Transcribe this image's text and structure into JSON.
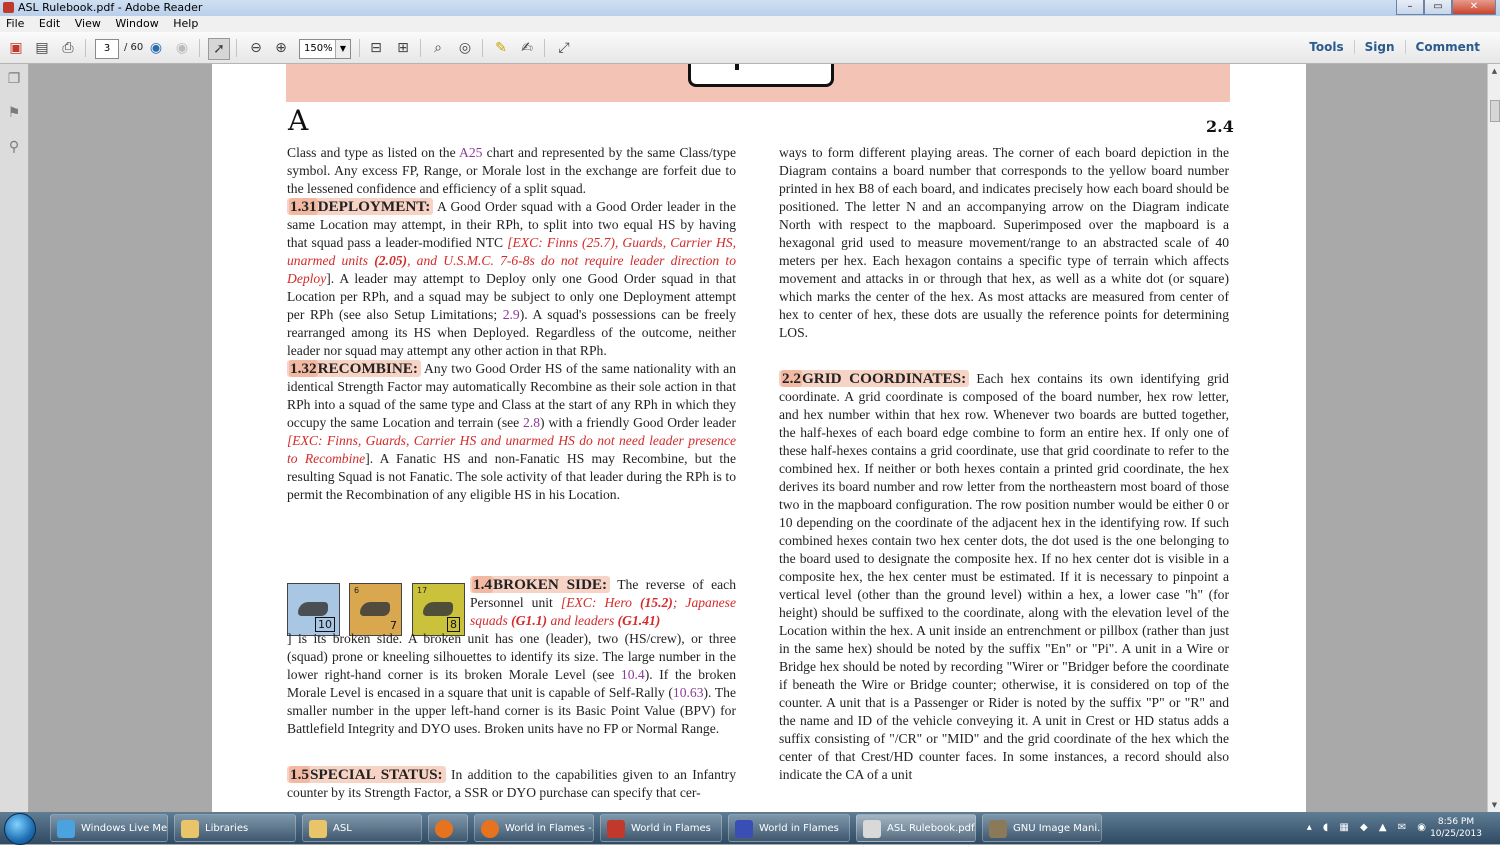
{
  "window": {
    "title": "ASL Rulebook.pdf - Adobe Reader",
    "min": "–",
    "max": "▭",
    "close": "✕"
  },
  "menu": [
    "File",
    "Edit",
    "View",
    "Window",
    "Help"
  ],
  "toolbar": {
    "page_current": "3",
    "page_total": "/ 60",
    "zoom": "150%",
    "links": {
      "tools": "Tools",
      "sign": "Sign",
      "comment": "Comment"
    }
  },
  "icons": {
    "create": "create-pdf-icon",
    "save": "save-icon",
    "print": "print-icon",
    "prev": "previous-page-icon",
    "next": "next-page-icon",
    "select": "select-tool-icon",
    "zoom_out": "zoom-out-icon",
    "zoom_in": "zoom-in-icon",
    "fit_page": "fit-page-icon",
    "fit_width": "fit-width-icon",
    "find": "find-icon",
    "binoculars": "binoculars-icon",
    "comment": "comment-icon",
    "sign": "sign-icon",
    "fullscreen": "fullscreen-icon"
  },
  "document": {
    "section_letter": "A",
    "section_number": "2.4",
    "left": {
      "p0": "Class and type as listed on the ",
      "p0_ref": "A25",
      "p0_b": " chart and represented by the same Class/type symbol. Any excess FP, Range, or Morale lost in the exchange are forfeit due to the lessened confidence and efficiency of a split squad.",
      "r131_num": "1.31",
      "r131_title": "DEPLOYMENT:",
      "r131_a": " A Good Order squad with a Good Order leader in the same Location may attempt, in their RPh, to split into two equal HS by having that squad pass a leader-modified NTC ",
      "r131_exc1": "[EXC: Finns (25.7), Guards, Carrier HS, unarmed units ",
      "r131_excb": "(2.05)",
      "r131_exc2": ", and U.S.M.C. 7-6-8s do not require leader direction to Deploy",
      "r131_b": "]. A leader may attempt to Deploy only one Good Order squad in that Location per RPh, and a squad may be subject to only one Deployment attempt per RPh (see also Setup Limitations; ",
      "r131_ref": "2.9",
      "r131_c": "). A squad's possessions can be freely rearranged among its HS when Deployed. Regardless of the outcome, neither leader nor squad may attempt any other action in that RPh.",
      "r132_num": "1.32",
      "r132_title": "RECOMBINE:",
      "r132_a": " Any two Good Order HS of the same nationality with an identical Strength Factor may automatically Recombine as their sole action in that RPh into a squad of the same type and Class at the start of any RPh in which they occupy the same Location and terrain (see ",
      "r132_ref": "2.8",
      "r132_b": ") with a friendly Good Order leader ",
      "r132_exc": "[EXC: Finns, Guards, Carrier HS and unarmed HS do not need leader presence to Recombine",
      "r132_c": "]. A Fanatic HS and non-Fanatic HS may Recombine, but the resulting Squad is not Fanatic. The sole activity of that leader during the RPh is to permit the Recombination of any eligible HS in his Location.",
      "r14_num": "1.4",
      "r14_title": "BROKEN SIDE:",
      "r14_a": " The reverse of each Personnel unit ",
      "r14_exc1": "[EXC: Hero ",
      "r14_excb1": "(15.2)",
      "r14_exc2": "; Japanese squads ",
      "r14_excb2": "(G1.1)",
      "r14_exc3": " and leaders ",
      "r14_excb3": "(G1.41)",
      "r14_b": "] is its broken side. A broken unit has one (leader), two (HS/crew), or three (squad) prone or kneeling silhouettes to identify its size. The large number in the lower right-hand corner is its broken Morale Level (see ",
      "r14_ref1": "10.4",
      "r14_c": "). If the broken Morale Level is encased in a square that unit is capable of Self-Rally (",
      "r14_ref2": "10.63",
      "r14_d": "). The smaller number in the upper left-hand corner is its Basic Point Value (BPV) for Battlefield Integrity and DYO uses. Broken units have no FP or Normal Range.",
      "r15_num": "1.5",
      "r15_title": "SPECIAL STATUS:",
      "r15_a": " In addition to the capabilities given to an Infantry counter by its Strength Factor, a SSR or DYO purchase can specify that cer-"
    },
    "counters": [
      {
        "bpv": "",
        "morale": "10",
        "boxed": true,
        "color": "#a9c7e3"
      },
      {
        "bpv": "6",
        "morale": "7",
        "boxed": false,
        "color": "#d9a84e"
      },
      {
        "bpv": "17",
        "morale": "8",
        "boxed": true,
        "color": "#c9c23a"
      }
    ],
    "right": {
      "p0": "ways to form different playing areas. The corner of each board depiction in the Diagram contains a board number that corresponds to the yellow board number printed in hex B8 of each board, and indicates precisely how each board should be positioned. The letter N and an accompanying arrow on the Diagram indicate North with respect to the mapboard. Superimposed over the mapboard is a hexagonal grid used to measure movement/range to an abstracted scale of 40 meters per hex. Each hexagon contains a specific type of terrain which affects movement and attacks in or through that hex, as well as a white dot (or square) which marks the center of the hex. As most attacks are measured from center of hex to center of hex, these dots are usually the reference points for determining LOS.",
      "r22_num": "2.2",
      "r22_title": "GRID COORDINATES:",
      "r22_text": " Each hex contains its own identifying grid coordinate. A grid coordinate is composed of the board number, hex row letter, and hex number within that hex row. Whenever two boards are butted together, the half-hexes of each board edge combine to form an entire hex. If only one of these half-hexes contains a grid coordinate, use that grid coordinate to refer to the combined hex. If neither or both hexes contain a printed grid coordinate, the hex derives its board number and row letter from the northeastern most board of those two in the mapboard configuration. The row position number would be either 0 or 10 depending on the coordinate of the adjacent hex in the identifying row. If such combined hexes contain two hex center dots, the dot used is the one belonging to the board used to designate the composite hex. If no hex center dot is visible in a composite hex, the hex center must be estimated. If it is necessary to pinpoint a vertical level (other than the ground level) within a hex, a lower case \"h\" (for height) should be suffixed to the coordinate, along with the elevation level of the Location within the hex. A unit inside an entrenchment or pillbox (rather than just in the same hex) should be noted by the suffix \"En\" or \"Pi\". A unit in a Wire or Bridge hex should be noted by recording \"Wirer or \"Bridger before the coordinate if beneath the Wire or Bridge counter; otherwise, it is considered on top of the counter. A unit that is a Passenger or Rider is noted by the suffix \"P\" or \"R\" and the name and ID of the vehicle conveying it. A unit in Crest or HD status adds a suffix consisting of \"/CR\" or \"MID\" and the grid coordinate of the hex which the center of that Crest/HD counter faces. In some instances, a record should also indicate the CA of a unit"
    }
  },
  "taskbar": {
    "items": [
      {
        "label": "Windows Live Me...",
        "color": "#4aa3df"
      },
      {
        "label": "Libraries",
        "color": "#e8c46a"
      },
      {
        "label": "ASL",
        "color": "#e8c46a"
      },
      {
        "label": "",
        "color": "#e8731f"
      },
      {
        "label": "World in Flames -...",
        "color": "#e8731f"
      },
      {
        "label": "World in Flames",
        "color": "#c0392b"
      },
      {
        "label": "World in Flames",
        "color": "#3a4fb5"
      },
      {
        "label": "ASL Rulebook.pdf...",
        "color": "#d9d9d9"
      },
      {
        "label": "GNU Image Mani...",
        "color": "#8a7a5a"
      }
    ],
    "time": "8:56 PM",
    "date": "10/25/2013"
  }
}
